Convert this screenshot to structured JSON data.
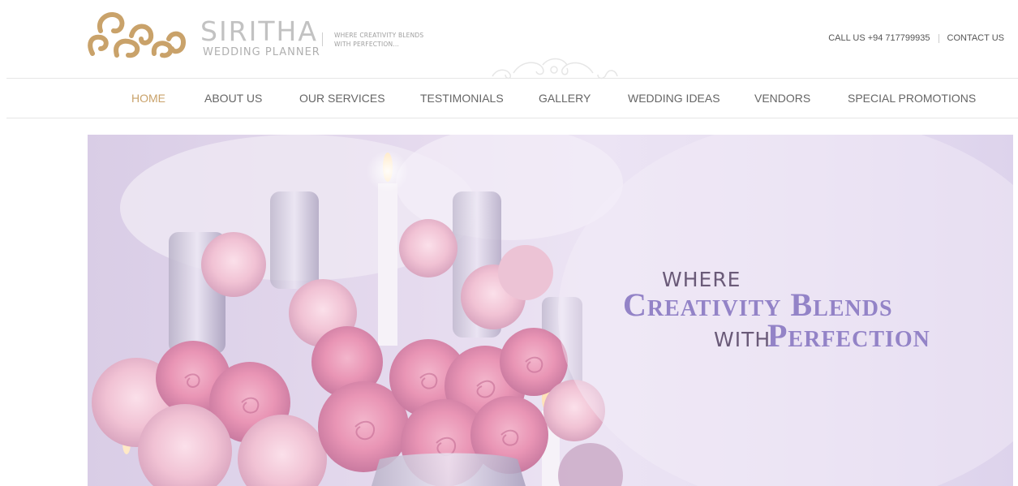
{
  "brand": {
    "name": "SIRITHA",
    "subtitle": "WEDDING PLANNER",
    "tagline_line1": "WHERE CREATIVITY BLENDS",
    "tagline_line2": "WITH PERFECTION..."
  },
  "contact": {
    "phone_text": "CALL US +94 717799935",
    "contact_label": "CONTACT US"
  },
  "nav": {
    "active": "HOME",
    "items": [
      "HOME",
      "ABOUT US",
      "OUR SERVICES",
      "TESTIMONIALS",
      "GALLERY",
      "WEDDING IDEAS",
      "VENDORS",
      "SPECIAL PROMOTIONS"
    ]
  },
  "hero": {
    "where": "WHERE",
    "line1": "Creativity Blends",
    "with": "WITH",
    "line2": "Perfection"
  },
  "colors": {
    "accent_gold": "#c9a26a",
    "hero_purple": "#9383c7"
  }
}
